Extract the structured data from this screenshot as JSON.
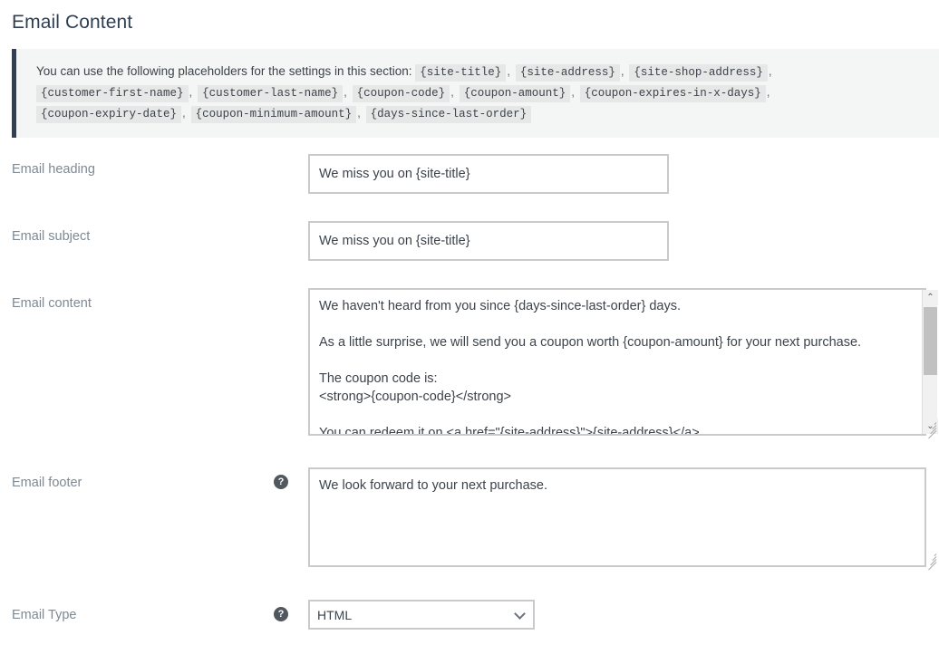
{
  "page": {
    "title": "Email Content"
  },
  "notice": {
    "intro": "You can use the following placeholders for the settings in this section:",
    "placeholders": [
      "{site-title}",
      "{site-address}",
      "{site-shop-address}",
      "{customer-first-name}",
      "{customer-last-name}",
      "{coupon-code}",
      "{coupon-amount}",
      "{coupon-expires-in-x-days}",
      "{coupon-expiry-date}",
      "{coupon-minimum-amount}",
      "{days-since-last-order}"
    ],
    "separator": ","
  },
  "fields": {
    "heading": {
      "label": "Email heading",
      "value": "We miss you on {site-title}"
    },
    "subject": {
      "label": "Email subject",
      "value": "We miss you on {site-title}"
    },
    "content": {
      "label": "Email content",
      "value": "We haven't heard from you since {days-since-last-order} days.\n\nAs a little surprise, we will send you a coupon worth {coupon-amount} for your next purchase.\n\nThe coupon code is:\n<strong>{coupon-code}</strong>\n\nYou can redeem it on <a href=\"{site-address}\">{site-address}</a>."
    },
    "footer": {
      "label": "Email footer",
      "value": "We look forward to your next purchase.",
      "help": "?"
    },
    "email_type": {
      "label": "Email Type",
      "value": "HTML",
      "help": "?",
      "options": [
        "HTML"
      ]
    }
  },
  "icons": {
    "scroll_up": "⌃",
    "scroll_down": "⌄"
  },
  "colors": {
    "notice_bar": "#2f4058",
    "notice_bg": "#f4f5f5",
    "label": "#7e8993",
    "title": "#2f3f52",
    "border": "#c9cacb",
    "chip_bg": "#e6e7e7"
  }
}
